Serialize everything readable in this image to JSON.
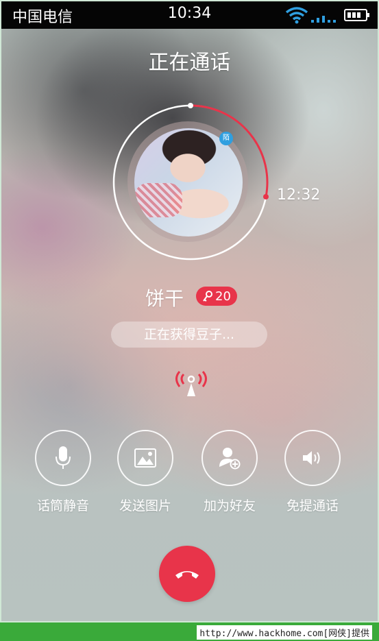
{
  "status_bar": {
    "carrier": "中国电信",
    "time": "10:34",
    "wifi_icon": "wifi-icon",
    "signal_icon": "signal-bars-icon",
    "battery_icon": "battery-icon"
  },
  "call": {
    "title": "正在通话",
    "duration": "12:32",
    "contact_name": "饼干",
    "bean_count": "20",
    "bean_icon": "key-icon",
    "status_text": "正在获得豆子...",
    "avatar_badge": "陌",
    "timer_progress_fraction": 0.28,
    "accent_color": "#e8344a"
  },
  "actions": [
    {
      "label": "话筒静音",
      "icon": "microphone-icon"
    },
    {
      "label": "发送图片",
      "icon": "image-icon"
    },
    {
      "label": "加为好友",
      "icon": "add-friend-icon"
    },
    {
      "label": "免提通话",
      "icon": "speaker-icon"
    }
  ],
  "hangup": {
    "icon": "hang-up-icon"
  },
  "footer": {
    "text": "http://www.hackhome.com[网侠]提供"
  }
}
